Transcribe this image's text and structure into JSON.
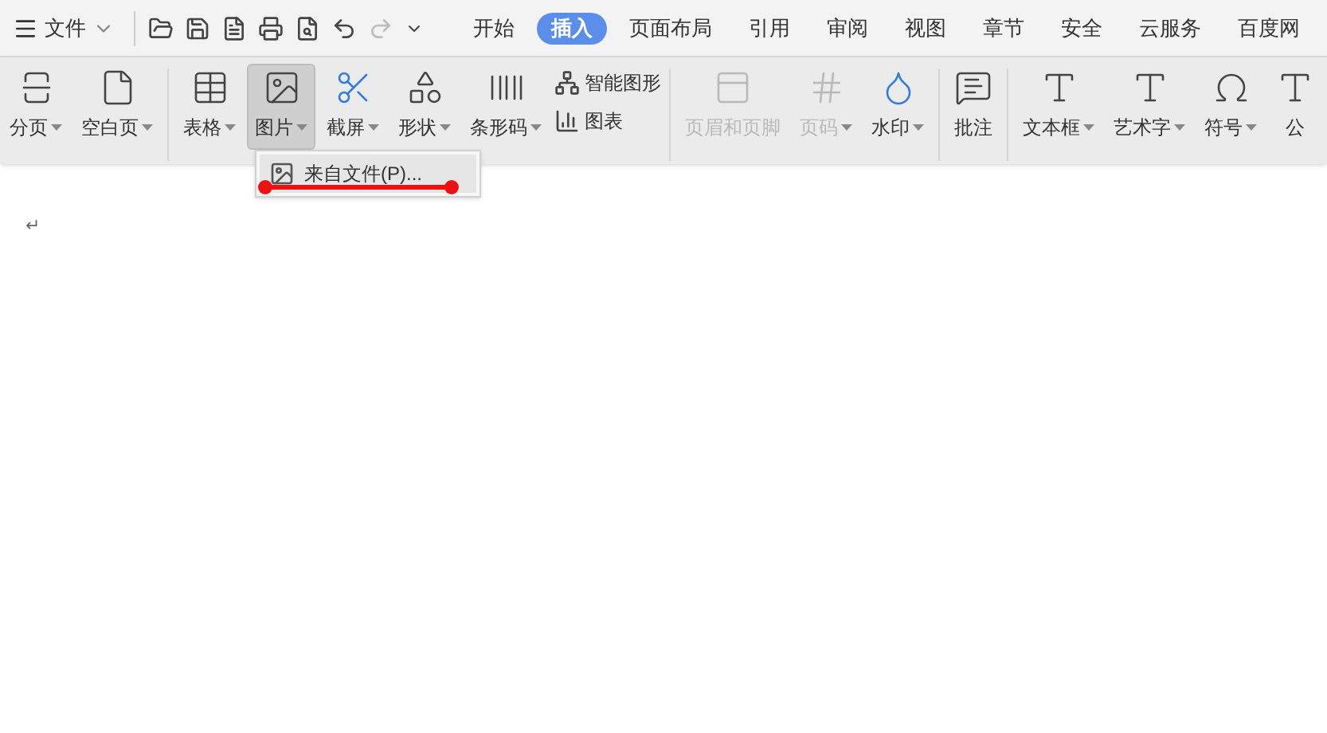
{
  "file_menu": {
    "label": "文件"
  },
  "tabs": [
    {
      "label": "开始",
      "selected": false
    },
    {
      "label": "插入",
      "selected": true
    },
    {
      "label": "页面布局",
      "selected": false
    },
    {
      "label": "引用",
      "selected": false
    },
    {
      "label": "审阅",
      "selected": false
    },
    {
      "label": "视图",
      "selected": false
    },
    {
      "label": "章节",
      "selected": false
    },
    {
      "label": "安全",
      "selected": false
    },
    {
      "label": "云服务",
      "selected": false
    },
    {
      "label": "百度网",
      "selected": false
    }
  ],
  "ribbon_groups": [
    [
      {
        "kind": "large",
        "label": "分页",
        "dropdown": true,
        "disabled": false,
        "selected": false
      },
      {
        "kind": "large",
        "label": "空白页",
        "dropdown": true,
        "disabled": false,
        "selected": false
      }
    ],
    [
      {
        "kind": "large",
        "label": "表格",
        "dropdown": true,
        "disabled": false,
        "selected": false
      },
      {
        "kind": "large",
        "label": "图片",
        "dropdown": true,
        "disabled": false,
        "selected": true
      },
      {
        "kind": "large",
        "label": "截屏",
        "dropdown": true,
        "disabled": false,
        "selected": false
      },
      {
        "kind": "large",
        "label": "形状",
        "dropdown": true,
        "disabled": false,
        "selected": false
      },
      {
        "kind": "large",
        "label": "条形码",
        "dropdown": true,
        "disabled": false,
        "selected": false
      },
      {
        "kind": "small_stack",
        "items": [
          {
            "label": "智能图形"
          },
          {
            "label": "图表"
          }
        ]
      }
    ],
    [
      {
        "kind": "large",
        "label": "页眉和页脚",
        "dropdown": false,
        "disabled": true,
        "selected": false
      },
      {
        "kind": "large",
        "label": "页码",
        "dropdown": true,
        "disabled": true,
        "selected": false
      },
      {
        "kind": "large",
        "label": "水印",
        "dropdown": true,
        "disabled": false,
        "selected": false
      }
    ],
    [
      {
        "kind": "large",
        "label": "批注",
        "dropdown": false,
        "disabled": false,
        "selected": false
      }
    ],
    [
      {
        "kind": "large",
        "label": "文本框",
        "dropdown": true,
        "disabled": false,
        "selected": false
      },
      {
        "kind": "large",
        "label": "艺术字",
        "dropdown": true,
        "disabled": false,
        "selected": false
      },
      {
        "kind": "large",
        "label": "符号",
        "dropdown": true,
        "disabled": false,
        "selected": false
      },
      {
        "kind": "large",
        "label": "公",
        "dropdown": false,
        "disabled": false,
        "selected": false
      }
    ]
  ],
  "dropdown_menu": {
    "items": [
      {
        "label": "来自文件(P)..."
      }
    ]
  },
  "document": {
    "paragraph_mark": "↵"
  }
}
